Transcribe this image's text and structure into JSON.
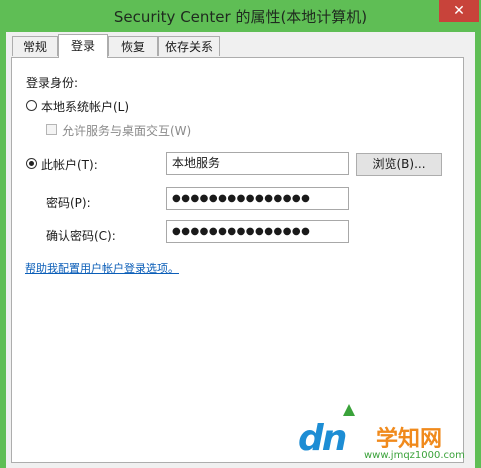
{
  "window": {
    "title": "Security Center 的属性(本地计算机)",
    "close_glyph": "✕"
  },
  "tabs": [
    {
      "label": "常规",
      "active": false
    },
    {
      "label": "登录",
      "active": true
    },
    {
      "label": "恢复",
      "active": false
    },
    {
      "label": "依存关系",
      "active": false
    }
  ],
  "logon": {
    "section_label": "登录身份:",
    "local_system": {
      "label": "本地系统帐户(L)",
      "selected": false
    },
    "desktop_interact": {
      "label": "允许服务与桌面交互(W)",
      "checked": false,
      "enabled": false
    },
    "this_account": {
      "label": "此帐户(T):",
      "selected": true,
      "value": "本地服务"
    },
    "browse_button": "浏览(B)...",
    "password": {
      "label": "密码(P):",
      "value": "●●●●●●●●●●●●●●●"
    },
    "confirm_password": {
      "label": "确认密码(C):",
      "value": "●●●●●●●●●●●●●●●"
    },
    "help_link": "帮助我配置用户帐户登录选项。"
  },
  "watermark": {
    "logo": "dn",
    "site_name": "学知网",
    "url": "www.jmqz1000.com"
  },
  "colors": {
    "titlebar": "#5fbe55",
    "close_button": "#c8433a",
    "link": "#0b5eb8"
  }
}
